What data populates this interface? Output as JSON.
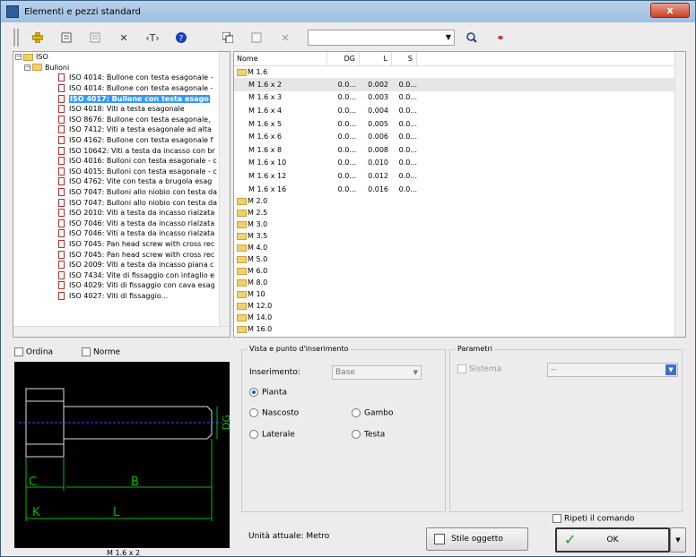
{
  "window": {
    "title": "Elementi e pezzi standard",
    "close_label": "x"
  },
  "toolbar": {
    "icons": [
      "add-icon",
      "properties-icon",
      "list-icon",
      "tools-icon",
      "text-icon",
      "help-icon",
      "copy-icon",
      "grid-icon",
      "delete-icon",
      "search-icon",
      "binoculars-icon"
    ],
    "search_value": ""
  },
  "tree": {
    "root": "ISO",
    "group": "Bulloni",
    "items": [
      "ISO 4014: Bullone con testa esagonale -",
      "ISO 4014: Bullone con testa esagonale -",
      "ISO 4017: Bullone con testa esago",
      "ISO 4018: Viti a testa esagonale",
      "ISO 8676: Bullone con testa esagonale,",
      "ISO 7412: Viti a testa esagonale ad alta",
      "ISO 4162: Bullone con testa esagonale f",
      "ISO 10642: Viti a testa da incasso con br",
      "ISO 4016: Bulloni con testa esagonale - c",
      "ISO 4015: Bulloni con testa esagonale - c",
      "ISO 4762: Vite con testa a brugola esag",
      "ISO 7047: Bulloni allo niobio con testa da",
      "ISO 7047: Bulloni allo niobio con testa da",
      "ISO 2010: Viti a testa da incasso rialzata",
      "ISO 7046: Viti a testa da incasso rialzata",
      "ISO 7046: Viti a testa da incasso rialzata",
      "ISO 7045: Pan head screw with cross rec",
      "ISO 7045: Pan head screw with cross rec",
      "ISO 2009: Viti a testa da incasso piana c",
      "ISO 7434: Vite di fissaggio con intaglio e",
      "ISO 4029: Viti di fissaggio con cava esag",
      "ISO 4027: Viti di fissaggio..."
    ],
    "selected_index": 2
  },
  "list": {
    "columns": [
      "Nome",
      "DG",
      "L",
      "S"
    ],
    "open_group": "M 1.6",
    "rows": [
      {
        "name": "M 1.6 x 2",
        "dg": "0.0...",
        "l": "0.002",
        "s": "0.0..."
      },
      {
        "name": "M 1.6 x 3",
        "dg": "0.0...",
        "l": "0.003",
        "s": "0.0..."
      },
      {
        "name": "M 1.6 x 4",
        "dg": "0.0...",
        "l": "0.004",
        "s": "0.0..."
      },
      {
        "name": "M 1.6 x 5",
        "dg": "0.0...",
        "l": "0.005",
        "s": "0.0..."
      },
      {
        "name": "M 1.6 x 6",
        "dg": "0.0...",
        "l": "0.006",
        "s": "0.0..."
      },
      {
        "name": "M 1.6 x 8",
        "dg": "0.0...",
        "l": "0.008",
        "s": "0.0..."
      },
      {
        "name": "M 1.6 x 10",
        "dg": "0.0...",
        "l": "0.010",
        "s": "0.0..."
      },
      {
        "name": "M 1.6 x 12",
        "dg": "0.0...",
        "l": "0.012",
        "s": "0.0..."
      },
      {
        "name": "M 1.6 x 16",
        "dg": "0.0...",
        "l": "0.016",
        "s": "0.0..."
      }
    ],
    "groups": [
      "M 2.0",
      "M 2.5",
      "M 3.0",
      "M 3.5",
      "M 4.0",
      "M 5.0",
      "M 6.0",
      "M 8.0",
      "M 10",
      "M 12.0",
      "M 14.0",
      "M 16.0"
    ]
  },
  "options": {
    "ordina": "Ordina",
    "norme": "Norme"
  },
  "preview": {
    "caption": "M 1.6 x 2",
    "labels": {
      "dg": "DG",
      "c": "C",
      "b": "B",
      "k": "K",
      "l": "L"
    }
  },
  "view": {
    "title": "Vista e punto d'inserimento",
    "insert_label": "Inserimento:",
    "insert_value": "Base",
    "radios": {
      "pianta": "Pianta",
      "nascosto": "Nascosto",
      "gambo": "Gambo",
      "laterale": "Laterale",
      "testa": "Testa"
    },
    "unit": "Unità attuale: Metro"
  },
  "params": {
    "title": "Parametri",
    "sistema": "Sistema",
    "sistema_value": "--"
  },
  "repeat": "Ripeti il comando",
  "buttons": {
    "style": "Stile oggetto",
    "ok": "OK"
  }
}
